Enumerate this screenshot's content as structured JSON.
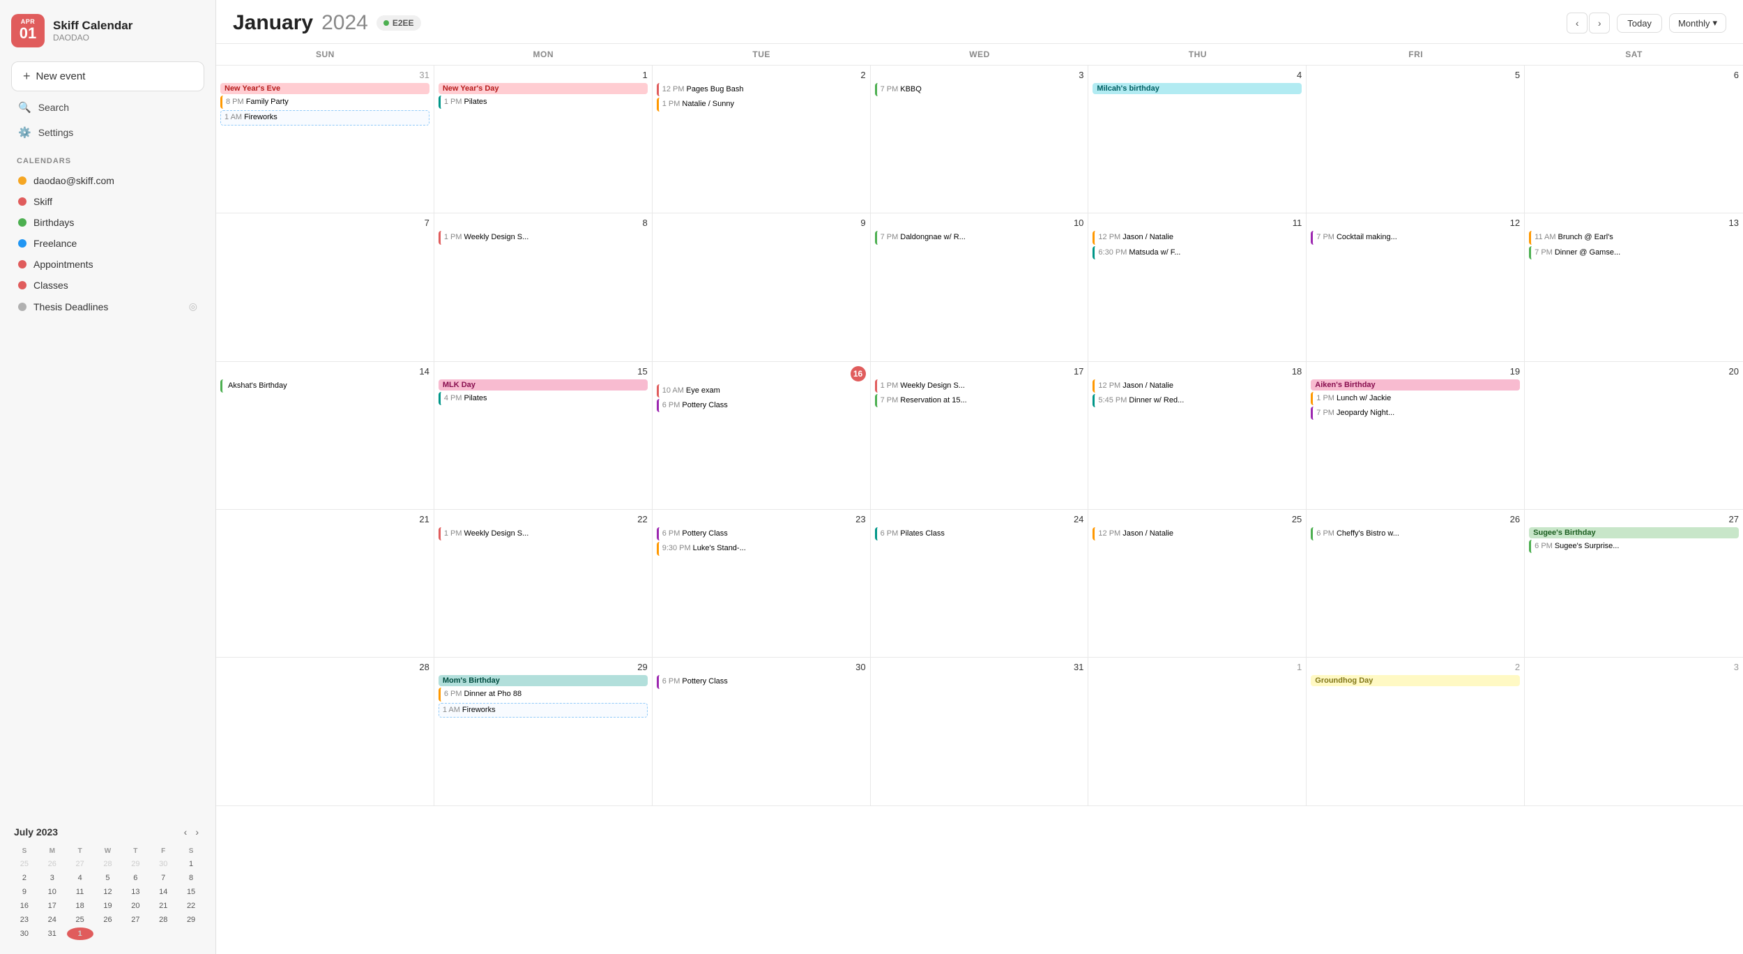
{
  "sidebar": {
    "app_name": "Skiff Calendar",
    "subtitle": "DAODAO",
    "month_label": "APR",
    "day_label": "01",
    "new_event_label": "New event",
    "search_label": "Search",
    "settings_label": "Settings",
    "calendars_section_label": "CALENDARS",
    "calendars": [
      {
        "id": "daodao",
        "name": "daodao@skiff.com",
        "color": "#f5a623"
      },
      {
        "id": "skiff",
        "name": "Skiff",
        "color": "#e05c5c"
      },
      {
        "id": "birthdays",
        "name": "Birthdays",
        "color": "#4caf50"
      },
      {
        "id": "freelance",
        "name": "Freelance",
        "color": "#2196f3"
      },
      {
        "id": "appointments",
        "name": "Appointments",
        "color": "#e05c5c"
      },
      {
        "id": "classes",
        "name": "Classes",
        "color": "#e05c5c"
      },
      {
        "id": "thesis",
        "name": "Thesis Deadlines",
        "color": "#b0b0b0"
      }
    ],
    "mini_cal": {
      "title": "July 2023",
      "day_headers": [
        "S",
        "M",
        "T",
        "W",
        "T",
        "F",
        "S"
      ],
      "days": [
        {
          "day": 25,
          "type": "prev"
        },
        {
          "day": 26,
          "type": "prev"
        },
        {
          "day": 27,
          "type": "prev"
        },
        {
          "day": 28,
          "type": "prev"
        },
        {
          "day": 29,
          "type": "prev"
        },
        {
          "day": 30,
          "type": "prev"
        },
        {
          "day": 1,
          "type": "current"
        },
        {
          "day": 2,
          "type": "current"
        },
        {
          "day": 3,
          "type": "current"
        },
        {
          "day": 4,
          "type": "current"
        },
        {
          "day": 5,
          "type": "current"
        },
        {
          "day": 6,
          "type": "current"
        },
        {
          "day": 7,
          "type": "current"
        },
        {
          "day": 8,
          "type": "current"
        },
        {
          "day": 9,
          "type": "current"
        },
        {
          "day": 10,
          "type": "current"
        },
        {
          "day": 11,
          "type": "current"
        },
        {
          "day": 12,
          "type": "current"
        },
        {
          "day": 13,
          "type": "current"
        },
        {
          "day": 14,
          "type": "current"
        },
        {
          "day": 15,
          "type": "current"
        },
        {
          "day": 16,
          "type": "current"
        },
        {
          "day": 17,
          "type": "current"
        },
        {
          "day": 18,
          "type": "current"
        },
        {
          "day": 19,
          "type": "current"
        },
        {
          "day": 20,
          "type": "current"
        },
        {
          "day": 21,
          "type": "current"
        },
        {
          "day": 22,
          "type": "current"
        },
        {
          "day": 23,
          "type": "current"
        },
        {
          "day": 24,
          "type": "current"
        },
        {
          "day": 25,
          "type": "current"
        },
        {
          "day": 26,
          "type": "current"
        },
        {
          "day": 27,
          "type": "current"
        },
        {
          "day": 28,
          "type": "current"
        },
        {
          "day": 29,
          "type": "current"
        },
        {
          "day": 30,
          "type": "current"
        },
        {
          "day": 31,
          "type": "current"
        },
        {
          "day": 1,
          "type": "next",
          "today": true
        }
      ]
    }
  },
  "header": {
    "month": "January",
    "year": "2024",
    "badge_label": "E2EE",
    "today_label": "Today",
    "view_label": "Monthly"
  },
  "calendar": {
    "day_headers": [
      "SUN",
      "MON",
      "TUE",
      "WED",
      "THU",
      "FRI",
      "SAT"
    ],
    "weeks": [
      {
        "cells": [
          {
            "date": 31,
            "type": "prev",
            "events": [
              {
                "type": "full",
                "cls": "fw-red",
                "text": "New Year's Eve"
              },
              {
                "type": "line",
                "cls": "ev-line-orange",
                "time": "8 PM",
                "title": "Family Party"
              },
              {
                "type": "dashed",
                "time": "1 AM",
                "title": "Fireworks"
              }
            ]
          },
          {
            "date": 1,
            "type": "current",
            "events": [
              {
                "type": "full",
                "cls": "fw-red",
                "text": "New Year's Day"
              },
              {
                "type": "line",
                "cls": "ev-line-teal",
                "time": "1 PM",
                "title": "Pilates"
              }
            ]
          },
          {
            "date": 2,
            "type": "current",
            "events": [
              {
                "type": "line",
                "cls": "ev-line-red",
                "time": "12 PM",
                "title": "Pages Bug Bash"
              },
              {
                "type": "line",
                "cls": "ev-line-orange",
                "time": "1 PM",
                "title": "Natalie / Sunny"
              }
            ]
          },
          {
            "date": 3,
            "type": "current",
            "events": [
              {
                "type": "line",
                "cls": "ev-line-green",
                "time": "7 PM",
                "title": "KBBQ"
              }
            ]
          },
          {
            "date": 4,
            "type": "current",
            "events": [
              {
                "type": "full",
                "cls": "fw-cyan",
                "text": "Milcah's birthday"
              }
            ]
          },
          {
            "date": 5,
            "type": "current",
            "events": []
          },
          {
            "date": 6,
            "type": "current",
            "events": []
          }
        ]
      },
      {
        "cells": [
          {
            "date": 7,
            "type": "current",
            "events": []
          },
          {
            "date": 8,
            "type": "current",
            "events": [
              {
                "type": "line",
                "cls": "ev-line-red",
                "time": "1 PM",
                "title": "Weekly Design S..."
              }
            ]
          },
          {
            "date": 9,
            "type": "current",
            "events": []
          },
          {
            "date": 10,
            "type": "current",
            "events": [
              {
                "type": "line",
                "cls": "ev-line-green",
                "time": "7 PM",
                "title": "Daldongnae w/ R..."
              }
            ]
          },
          {
            "date": 11,
            "type": "current",
            "events": [
              {
                "type": "line",
                "cls": "ev-line-orange",
                "time": "12 PM",
                "title": "Jason / Natalie"
              },
              {
                "type": "line",
                "cls": "ev-line-teal",
                "time": "6:30 PM",
                "title": "Matsuda w/ F..."
              }
            ]
          },
          {
            "date": 12,
            "type": "current",
            "events": [
              {
                "type": "line",
                "cls": "ev-line-purple",
                "time": "7 PM",
                "title": "Cocktail making..."
              }
            ]
          },
          {
            "date": 13,
            "type": "current",
            "events": [
              {
                "type": "line",
                "cls": "ev-line-orange",
                "time": "11 AM",
                "title": "Brunch @ Earl's"
              },
              {
                "type": "line",
                "cls": "ev-line-green",
                "time": "7 PM",
                "title": "Dinner @ Gamse..."
              }
            ]
          }
        ]
      },
      {
        "cells": [
          {
            "date": 14,
            "type": "current",
            "events": [
              {
                "type": "line",
                "cls": "ev-line-green",
                "time": "",
                "title": "Akshat's Birthday"
              }
            ]
          },
          {
            "date": 15,
            "type": "current",
            "events": [
              {
                "type": "full",
                "cls": "fw-pink",
                "text": "MLK Day"
              },
              {
                "type": "line",
                "cls": "ev-line-teal",
                "time": "4 PM",
                "title": "Pilates"
              }
            ]
          },
          {
            "date": 16,
            "type": "current",
            "today": true,
            "events": [
              {
                "type": "line",
                "cls": "ev-line-red",
                "time": "10 AM",
                "title": "Eye exam"
              },
              {
                "type": "line",
                "cls": "ev-line-purple",
                "time": "6 PM",
                "title": "Pottery Class"
              }
            ]
          },
          {
            "date": 17,
            "type": "current",
            "events": [
              {
                "type": "line",
                "cls": "ev-line-red",
                "time": "1 PM",
                "title": "Weekly Design S..."
              },
              {
                "type": "line",
                "cls": "ev-line-green",
                "time": "7 PM",
                "title": "Reservation at 15..."
              }
            ]
          },
          {
            "date": 18,
            "type": "current",
            "events": [
              {
                "type": "line",
                "cls": "ev-line-orange",
                "time": "12 PM",
                "title": "Jason / Natalie"
              },
              {
                "type": "line",
                "cls": "ev-line-teal",
                "time": "5:45 PM",
                "title": "Dinner w/ Red..."
              }
            ]
          },
          {
            "date": 19,
            "type": "current",
            "events": [
              {
                "type": "full",
                "cls": "fw-pink",
                "text": "Aiken's Birthday"
              },
              {
                "type": "line",
                "cls": "ev-line-orange",
                "time": "1 PM",
                "title": "Lunch w/ Jackie"
              },
              {
                "type": "line",
                "cls": "ev-line-purple",
                "time": "7 PM",
                "title": "Jeopardy Night..."
              }
            ]
          },
          {
            "date": 20,
            "type": "current",
            "events": []
          }
        ]
      },
      {
        "cells": [
          {
            "date": 21,
            "type": "current",
            "events": []
          },
          {
            "date": 22,
            "type": "current",
            "events": [
              {
                "type": "line",
                "cls": "ev-line-red",
                "time": "1 PM",
                "title": "Weekly Design S..."
              }
            ]
          },
          {
            "date": 23,
            "type": "current",
            "events": [
              {
                "type": "line",
                "cls": "ev-line-purple",
                "time": "6 PM",
                "title": "Pottery Class"
              },
              {
                "type": "line",
                "cls": "ev-line-orange",
                "time": "9:30 PM",
                "title": "Luke's Stand-..."
              }
            ]
          },
          {
            "date": 24,
            "type": "current",
            "events": [
              {
                "type": "line",
                "cls": "ev-line-teal",
                "time": "6 PM",
                "title": "Pilates Class"
              }
            ]
          },
          {
            "date": 25,
            "type": "current",
            "events": [
              {
                "type": "line",
                "cls": "ev-line-orange",
                "time": "12 PM",
                "title": "Jason / Natalie"
              }
            ]
          },
          {
            "date": 26,
            "type": "current",
            "events": [
              {
                "type": "line",
                "cls": "ev-line-green",
                "time": "6 PM",
                "title": "Cheffy's Bistro w..."
              }
            ]
          },
          {
            "date": 27,
            "type": "current",
            "events": [
              {
                "type": "full",
                "cls": "fw-green",
                "text": "Sugee's Birthday"
              },
              {
                "type": "line",
                "cls": "ev-line-green",
                "time": "6 PM",
                "title": "Sugee's Surprise..."
              }
            ]
          }
        ]
      },
      {
        "cells": [
          {
            "date": 28,
            "type": "current",
            "events": []
          },
          {
            "date": 29,
            "type": "current",
            "events": [
              {
                "type": "full",
                "cls": "fw-teal",
                "text": "Mom's Birthday"
              },
              {
                "type": "line",
                "cls": "ev-line-orange",
                "time": "6 PM",
                "title": "Dinner at Pho 88"
              },
              {
                "type": "dashed",
                "time": "1 AM",
                "title": "Fireworks"
              }
            ]
          },
          {
            "date": 30,
            "type": "current",
            "events": [
              {
                "type": "line",
                "cls": "ev-line-purple",
                "time": "6 PM",
                "title": "Pottery Class"
              }
            ]
          },
          {
            "date": 31,
            "type": "current",
            "events": []
          },
          {
            "date": 1,
            "type": "next",
            "events": []
          },
          {
            "date": 2,
            "type": "next",
            "events": [
              {
                "type": "full",
                "cls": "fw-yellow",
                "text": "Groundhog Day"
              }
            ]
          },
          {
            "date": 3,
            "type": "next",
            "events": []
          }
        ]
      }
    ]
  }
}
